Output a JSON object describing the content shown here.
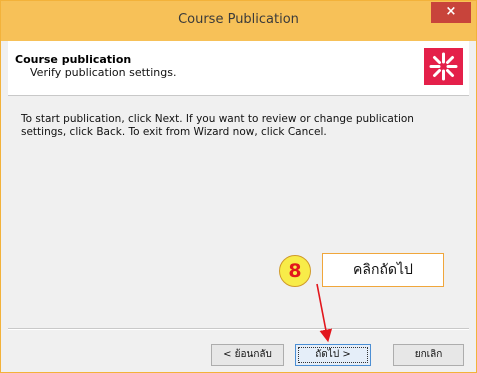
{
  "window": {
    "title": "Course Publication",
    "close_label": "×"
  },
  "header": {
    "title": "Course publication",
    "subtitle": "Verify publication settings."
  },
  "body": {
    "instructions": "To start publication, click Next.  If you want to review or change publication settings, click Back.  To exit from Wizard now, click Cancel."
  },
  "buttons": {
    "back": "< ย้อนกลับ",
    "next": "ถัดไป >",
    "cancel": "ยกเลิก"
  },
  "annotation": {
    "step": "8",
    "label": "คลิกถัดไป"
  },
  "colors": {
    "title_bar": "#f7c158",
    "close_button": "#c8443b",
    "logo": "#e4204a",
    "annotation_arrow": "#e2161c"
  }
}
